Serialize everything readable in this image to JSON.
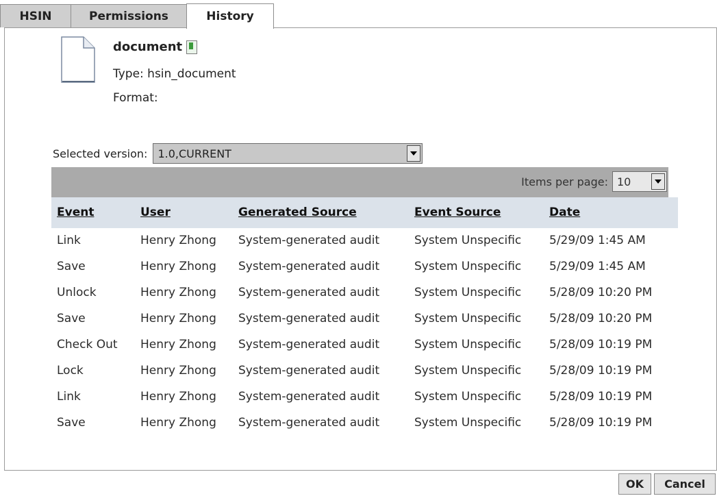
{
  "tabs": [
    {
      "label": "HSIN"
    },
    {
      "label": "Permissions"
    },
    {
      "label": "History",
      "active": true
    }
  ],
  "document": {
    "name": "document",
    "type_text": "Type: hsin_document",
    "format_text": "Format:"
  },
  "version": {
    "label": "Selected version:",
    "selected": "1.0,CURRENT"
  },
  "pagination": {
    "label": "Items per page:",
    "value": "10"
  },
  "table": {
    "headers": [
      "Event",
      "User",
      "Generated Source",
      "Event Source",
      "Date"
    ],
    "rows": [
      [
        "Link",
        "Henry Zhong",
        "System-generated audit",
        "System Unspecific",
        "5/29/09 1:45 AM"
      ],
      [
        "Save",
        "Henry Zhong",
        "System-generated audit",
        "System Unspecific",
        "5/29/09 1:45 AM"
      ],
      [
        "Unlock",
        "Henry Zhong",
        "System-generated audit",
        "System Unspecific",
        "5/28/09 10:20 PM"
      ],
      [
        "Save",
        "Henry Zhong",
        "System-generated audit",
        "System Unspecific",
        "5/28/09 10:20 PM"
      ],
      [
        "Check Out",
        "Henry Zhong",
        "System-generated audit",
        "System Unspecific",
        "5/28/09 10:19 PM"
      ],
      [
        "Lock",
        "Henry Zhong",
        "System-generated audit",
        "System Unspecific",
        "5/28/09 10:19 PM"
      ],
      [
        "Link",
        "Henry Zhong",
        "System-generated audit",
        "System Unspecific",
        "5/28/09 10:19 PM"
      ],
      [
        "Save",
        "Henry Zhong",
        "System-generated audit",
        "System Unspecific",
        "5/28/09 10:19 PM"
      ]
    ]
  },
  "buttons": {
    "ok": "OK",
    "cancel": "Cancel"
  },
  "icons": {
    "document": "document-icon",
    "bookmark": "bookmark-icon",
    "dropdown": "chevron-down-icon"
  }
}
